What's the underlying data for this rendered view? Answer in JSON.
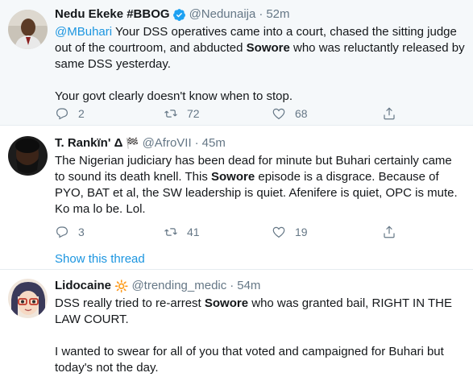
{
  "tweets": [
    {
      "display_name": "Nedu Ekeke #BBOG",
      "verified": true,
      "handle": "@Nedunaija",
      "separator": "·",
      "time": "52m",
      "mention": "@MBuhari",
      "text_a": " Your DSS operatives came into a court, chased the sitting judge out of the courtroom, and abducted ",
      "bold": "Sowore",
      "text_b": " who was reluctantly released by same DSS yesterday.",
      "text_c": "Your govt clearly doesn't know when to stop.",
      "replies": "2",
      "retweets": "72",
      "likes": "68"
    },
    {
      "display_name": "T. Rankïn' Δ",
      "flag": "🏁",
      "handle": "@AfroVII",
      "separator": "·",
      "time": "45m",
      "text_a": "The Nigerian judiciary has been dead for minute but Buhari certainly came to sound its death knell. This ",
      "bold": "Sowore",
      "text_b": " episode is a disgrace. Because of PYO, BAT et al, the SW leadership is quiet. Afenifere is quiet, OPC is mute.  Ko ma lo be. Lol.",
      "replies": "3",
      "retweets": "41",
      "likes": "19",
      "show_thread": "Show this thread"
    },
    {
      "display_name": "Lidocaine",
      "emoji": "🔆",
      "handle": "@trending_medic",
      "separator": "·",
      "time": "54m",
      "text_a": "DSS really tried to re-arrest ",
      "bold": "Sowore",
      "text_b": " who was granted bail, RIGHT IN THE LAW COURT.",
      "text_c": "I wanted to swear for all of you that voted and campaigned for Buhari but today's not the day."
    }
  ],
  "colors": {
    "link": "#1b95e0",
    "secondary": "#657786",
    "highlight_bg": "#f5f8fa",
    "verified": "#1da1f2"
  },
  "icons": {
    "reply": "reply-icon",
    "retweet": "retweet-icon",
    "like": "heart-icon",
    "share": "share-icon",
    "verified": "verified-badge-icon"
  }
}
